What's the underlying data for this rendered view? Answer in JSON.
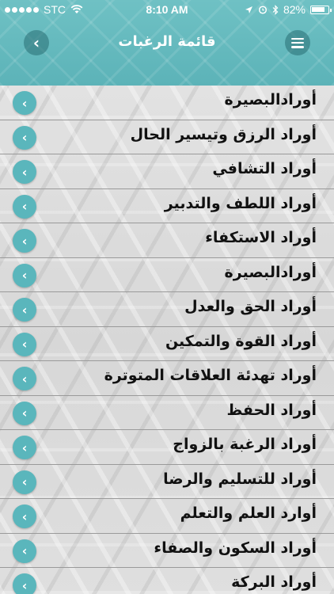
{
  "status_bar": {
    "carrier": "STC",
    "time": "8:10 AM",
    "battery": "82%",
    "battery_level": 0.82
  },
  "nav": {
    "title": "قائمة الرغبات",
    "back_icon": "chevron-left-icon",
    "menu_icon": "hamburger-icon"
  },
  "list": {
    "chevron_icon": "chevron-left-icon",
    "items": [
      "أورادالبصيرة",
      "أوراد الرزق وتيسير الحال",
      "أوراد التشافي",
      "أوراد اللطف والتدبير",
      "أوراد الاستكفاء",
      "أورادالبصيرة",
      "أوراد الحق والعدل",
      "أوراد القوة والتمكين",
      "أوراد تهدئة العلاقات المتوترة",
      "أوراد الحفظ",
      "أوراد الرغبة بالزواج",
      "أوراد للتسليم والرضا",
      "أوارد العلم والتعلم",
      "أوراد السكون والصفاء",
      "أوراد البركة"
    ]
  },
  "colors": {
    "accent": "#5ab6bc",
    "header": "#6fc1c4"
  }
}
